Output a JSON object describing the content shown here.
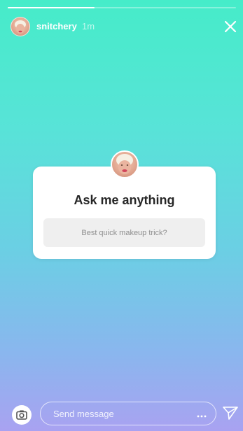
{
  "story": {
    "progress": 0.38,
    "background_colors": [
      "#46ecc9",
      "#6bcfe4",
      "#a9a2f1"
    ]
  },
  "header": {
    "username": "snitchery",
    "timestamp": "1m",
    "avatar_icon": "avatar",
    "close_icon": "close-icon"
  },
  "question_sticker": {
    "title": "Ask me anything",
    "placeholder": "Best quick makeup trick?",
    "background": "#ffffff",
    "input_background": "#efefef"
  },
  "footer": {
    "camera_icon": "camera-icon",
    "message_placeholder": "Send message",
    "more_icon": "more-options-icon",
    "send_icon": "send-icon"
  }
}
